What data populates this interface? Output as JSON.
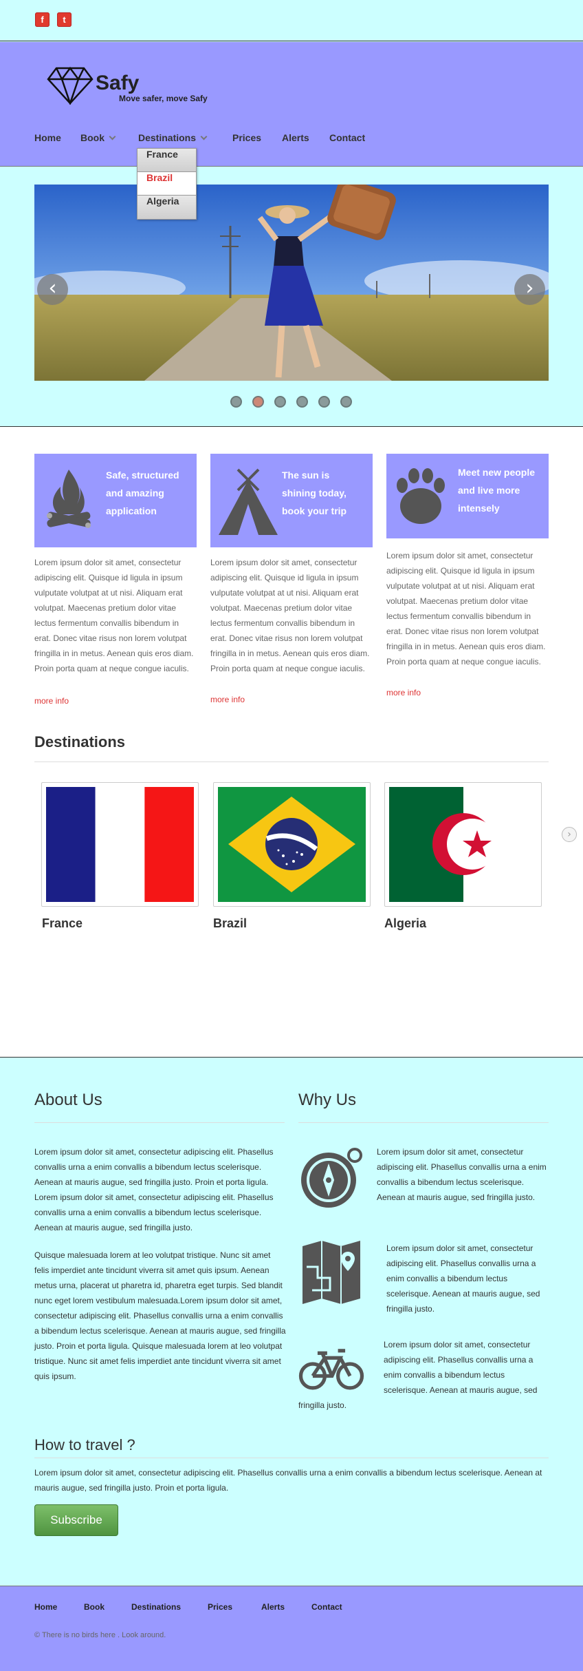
{
  "social": {
    "facebook_glyph": "f",
    "twitter_glyph": "t"
  },
  "brand": {
    "name": "Safy",
    "tagline": "Move safer, move Safy"
  },
  "nav": [
    {
      "label": "Home"
    },
    {
      "label": "Book"
    },
    {
      "label": "Destinations"
    },
    {
      "label": "Prices"
    },
    {
      "label": "Alerts"
    },
    {
      "label": "Contact"
    }
  ],
  "dropdown": [
    {
      "label": "France"
    },
    {
      "label": "Brazil"
    },
    {
      "label": "Algeria"
    }
  ],
  "slider": {
    "prev_glyph": "‹",
    "next_glyph": "›",
    "slide_count": 6,
    "active_slide": 2
  },
  "features": [
    {
      "title": "Safe, structured and amazing application",
      "text": "Lorem ipsum dolor sit amet, consectetur adipiscing elit. Quisque id ligula in ipsum vulputate volutpat at ut nisi. Aliquam erat volutpat. Maecenas pretium dolor vitae lectus fermentum convallis bibendum in erat. Donec vitae risus non lorem volutpat fringilla in in metus. Aenean quis eros diam. Proin porta quam at neque congue iaculis.",
      "link": "more info"
    },
    {
      "title": "The sun is shining today, book your trip",
      "text": "Lorem ipsum dolor sit amet, consectetur adipiscing elit. Quisque id ligula in ipsum vulputate volutpat at ut nisi. Aliquam erat volutpat. Maecenas pretium dolor vitae lectus fermentum convallis bibendum in erat. Donec vitae risus non lorem volutpat fringilla in in metus. Aenean quis eros diam. Proin porta quam at neque congue iaculis.",
      "link": "more info"
    },
    {
      "title": "Meet new people and live more intensely",
      "text": "Lorem ipsum dolor sit amet, consectetur adipiscing elit. Quisque id ligula in ipsum vulputate volutpat at ut nisi. Aliquam erat volutpat. Maecenas pretium dolor vitae lectus fermentum convallis bibendum in erat. Donec vitae risus non lorem volutpat fringilla in in metus. Aenean quis eros diam. Proin porta quam at neque congue iaculis.",
      "link": "more info"
    }
  ],
  "destinations": {
    "title": "Destinations",
    "items": [
      {
        "name": "France"
      },
      {
        "name": "Brazil"
      },
      {
        "name": "Algeria"
      }
    ],
    "next_glyph": "›"
  },
  "about": {
    "title": "About Us",
    "p1": "Lorem ipsum dolor sit amet, consectetur adipiscing elit. Phasellus convallis urna a enim convallis a bibendum lectus scelerisque. Aenean at mauris augue, sed fringilla justo. Proin et porta ligula. Lorem ipsum dolor sit amet, consectetur adipiscing elit. Phasellus convallis urna a enim convallis a bibendum lectus scelerisque. Aenean at mauris augue, sed fringilla justo.",
    "p2": "Quisque malesuada lorem at leo volutpat tristique. Nunc sit amet felis imperdiet ante tincidunt viverra sit amet quis ipsum. Aenean metus urna, placerat ut pharetra id, pharetra eget turpis. Sed blandit nunc eget lorem vestibulum malesuada.Lorem ipsum dolor sit amet, consectetur adipiscing elit. Phasellus convallis urna a enim convallis a bibendum lectus scelerisque. Aenean at mauris augue, sed fringilla justo. Proin et porta ligula. Quisque malesuada lorem at leo volutpat tristique. Nunc sit amet felis imperdiet ante tincidunt viverra sit amet quis ipsum."
  },
  "why": {
    "title": "Why Us",
    "items": [
      {
        "icon": "compass-icon",
        "text": "Lorem ipsum dolor sit amet, consectetur adipiscing elit. Phasellus convallis urna a enim convallis a bibendum lectus scelerisque. Aenean at mauris augue, sed fringilla justo."
      },
      {
        "icon": "map-icon",
        "text": "Lorem ipsum dolor sit amet, consectetur adipiscing elit. Phasellus convallis urna a enim convallis a bibendum lectus scelerisque. Aenean at mauris augue, sed fringilla justo."
      },
      {
        "icon": "bicycle-icon",
        "text_a": "Lorem ipsum dolor sit amet, consectetur adipiscing elit. Phasellus convallis urna a enim convallis a bibendum lectus scelerisque. Aenean at mauris augue, sed",
        "text_b": "fringilla justo."
      }
    ]
  },
  "howto": {
    "title": "How to travel ?",
    "text": "Lorem ipsum dolor sit amet, consectetur adipiscing elit. Phasellus convallis urna a enim convallis a bibendum lectus scelerisque. Aenean at mauris augue, sed fringilla justo. Proin et porta ligula.",
    "button": "Subscribe"
  },
  "footer": {
    "nav": [
      {
        "label": "Home"
      },
      {
        "label": "Book"
      },
      {
        "label": "Destinations"
      },
      {
        "label": "Prices"
      },
      {
        "label": "Alerts"
      },
      {
        "label": "Contact"
      }
    ],
    "copyright": "© There is no birds here . Look around."
  },
  "colors": {
    "page_bg": "#ccffff",
    "header_bg": "#9999ff",
    "accent_red": "#dd3333",
    "icon_gray": "#555555"
  }
}
